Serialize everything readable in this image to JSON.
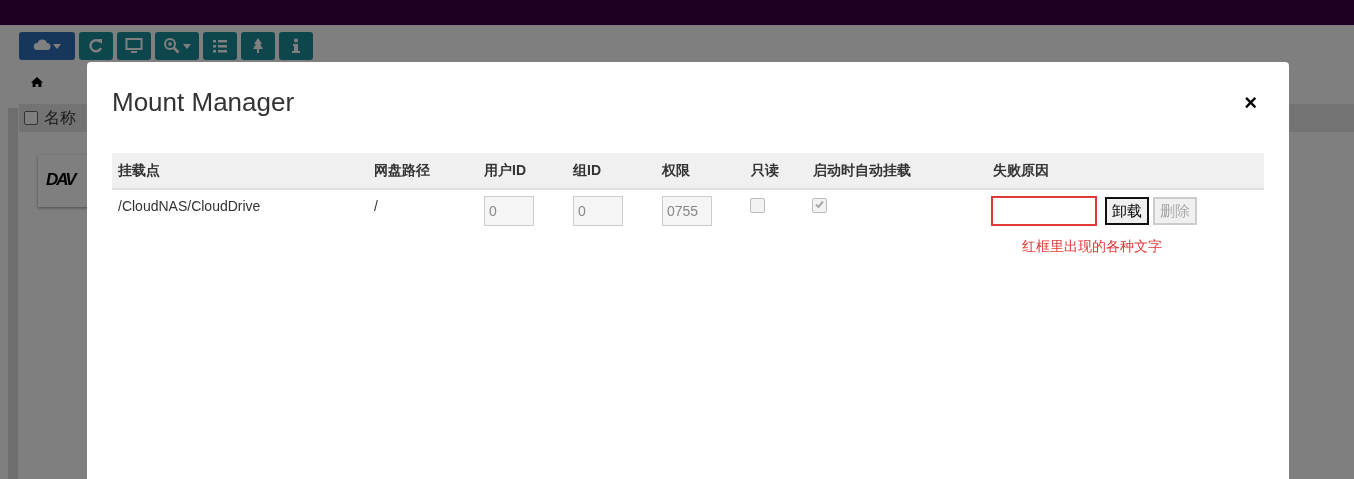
{
  "toolbar": {
    "buttons": [
      {
        "kind": "cloud",
        "caret": true,
        "active": true
      },
      {
        "kind": "refresh",
        "caret": false,
        "active": false
      },
      {
        "kind": "monitor",
        "caret": false,
        "active": false
      },
      {
        "kind": "zoom",
        "caret": true,
        "active": false
      },
      {
        "kind": "list",
        "caret": false,
        "active": false
      },
      {
        "kind": "tree",
        "caret": false,
        "active": false
      },
      {
        "kind": "info",
        "caret": false,
        "active": false
      }
    ]
  },
  "file_list": {
    "header": {
      "checked": false,
      "label": "名称"
    },
    "card": {
      "logo": "DAV"
    }
  },
  "dialog": {
    "title": "Mount Manager",
    "close": "×",
    "columns": [
      "挂载点",
      "网盘路径",
      "用户ID",
      "组ID",
      "权限",
      "只读",
      "启动时自动挂载",
      "失败原因"
    ],
    "rows": [
      {
        "mount_point": "/CloudNAS/CloudDrive",
        "cloud_path": "/",
        "user_id": "0",
        "group_id": "0",
        "permission": "0755",
        "readonly": false,
        "auto_mount": true,
        "failure_highlighted": true,
        "buttons": [
          {
            "label": "卸载",
            "disabled": false
          },
          {
            "label": "删除",
            "disabled": true
          }
        ]
      }
    ],
    "annotation": "红框里出现的各种文字"
  }
}
